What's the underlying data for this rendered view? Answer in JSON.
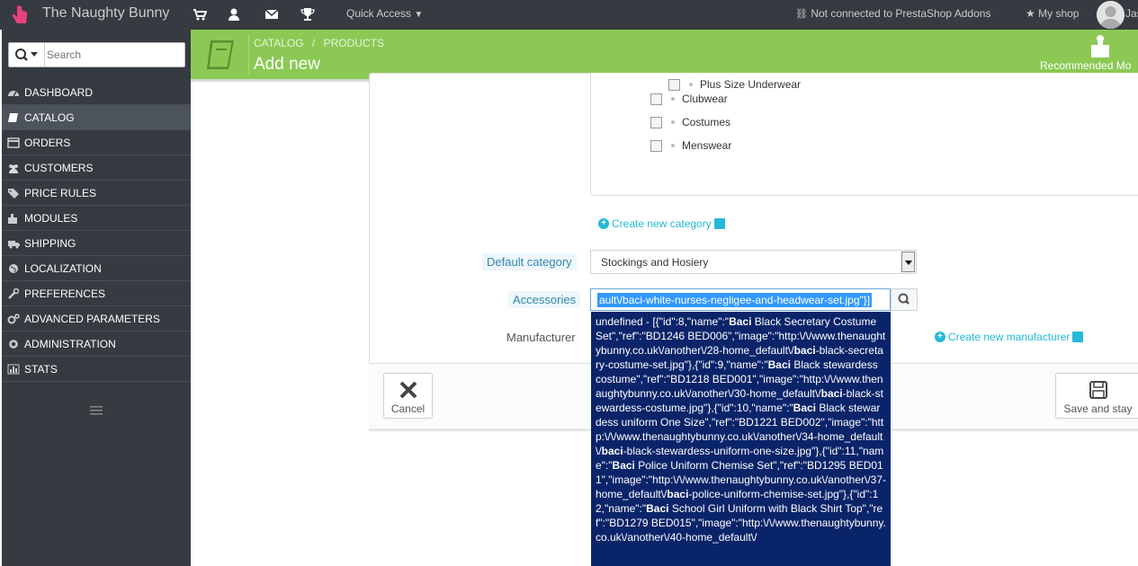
{
  "topbar": {
    "shop_name": "The Naughty Bunny",
    "quick_access": "Quick Access",
    "addons": "Not connected to PrestaShop Addons",
    "my_shop": "My shop",
    "username": "Jas"
  },
  "sidebar": {
    "search_placeholder": "Search",
    "items": [
      {
        "label": "DASHBOARD",
        "icon": "dashboard-icon"
      },
      {
        "label": "CATALOG",
        "icon": "book-icon"
      },
      {
        "label": "ORDERS",
        "icon": "credit-card-icon"
      },
      {
        "label": "CUSTOMERS",
        "icon": "users-icon"
      },
      {
        "label": "PRICE RULES",
        "icon": "tags-icon"
      },
      {
        "label": "MODULES",
        "icon": "puzzle-icon"
      },
      {
        "label": "SHIPPING",
        "icon": "truck-icon"
      },
      {
        "label": "LOCALIZATION",
        "icon": "globe-icon"
      },
      {
        "label": "PREFERENCES",
        "icon": "wrench-icon"
      },
      {
        "label": "ADVANCED PARAMETERS",
        "icon": "cogs-icon"
      },
      {
        "label": "ADMINISTRATION",
        "icon": "cog-icon"
      },
      {
        "label": "STATS",
        "icon": "bar-chart-icon"
      }
    ]
  },
  "header": {
    "breadcrumb_1": "CATALOG",
    "breadcrumb_sep": "/",
    "breadcrumb_2": "PRODUCTS",
    "title": "Add new",
    "recommended": "Recommended Mo"
  },
  "tree": {
    "items": [
      "Plus Size Underwear",
      "Clubwear",
      "Costumes",
      "Menswear"
    ]
  },
  "form": {
    "create_category": "Create new category",
    "default_category_label": "Default category",
    "default_category_value": "Stockings and Hosiery",
    "accessories_label": "Accessories",
    "accessories_value": "ault\\/baci-white-nurses-negligee-and-headwear-set.jpg\"}]",
    "manufacturer_label": "Manufacturer",
    "create_manufacturer": "Create new manufacturer"
  },
  "autocomplete": {
    "lines": [
      "undefined - [{\"id\":8,\"name\":\"",
      "Baci",
      " Black Secretary Costume Set\",\"ref\":\"BD1246 BED006\",\"image\":\"http:\\/\\/www.thenaughtybunny.co.uk\\/another\\/28-home_default\\/",
      "baci",
      "-black-secretary-costume-set.jpg\"},{\"id\":9,\"name\":\"",
      "Baci",
      " Black stewardess costume\",\"ref\":\"BD1218 BED001\",\"image\":\"http:\\/\\/www.thenaughtybunny.co.uk\\/another\\/30-home_default\\/",
      "baci",
      "-black-stewardess-costume.jpg\"},{\"id\":10,\"name\":\"",
      "Baci",
      " Black stewardess uniform One Size\",\"ref\":\"BD1221 BED002\",\"image\":\"http:\\/\\/www.thenaughtybunny.co.uk\\/another\\/34-home_default\\/",
      "baci",
      "-black-stewardess-uniform-one-size.jpg\"},{\"id\":11,\"name\":\"",
      "Baci",
      " Police Uniform Chemise Set\",\"ref\":\"BD1295 BED011\",\"image\":\"http:\\/\\/www.thenaughtybunny.co.uk\\/another\\/37-home_default\\/",
      "baci",
      "-police-uniform-chemise-set.jpg\"},{\"id\":12,\"name\":\"",
      "Baci",
      " School Girl Uniform with Black Shirt Top\",\"ref\":\"BD1279 BED015\",\"image\":\"http:\\/\\/www.thenaughtybunny.co.uk\\/another\\/40-home_default\\/"
    ]
  },
  "footer": {
    "cancel": "Cancel",
    "save_stay": "Save and stay"
  },
  "colors": {
    "header_green": "#8bc954",
    "topbar": "#363a41",
    "link_blue": "#25b9d7",
    "dropdown_bg": "#0a246a"
  }
}
